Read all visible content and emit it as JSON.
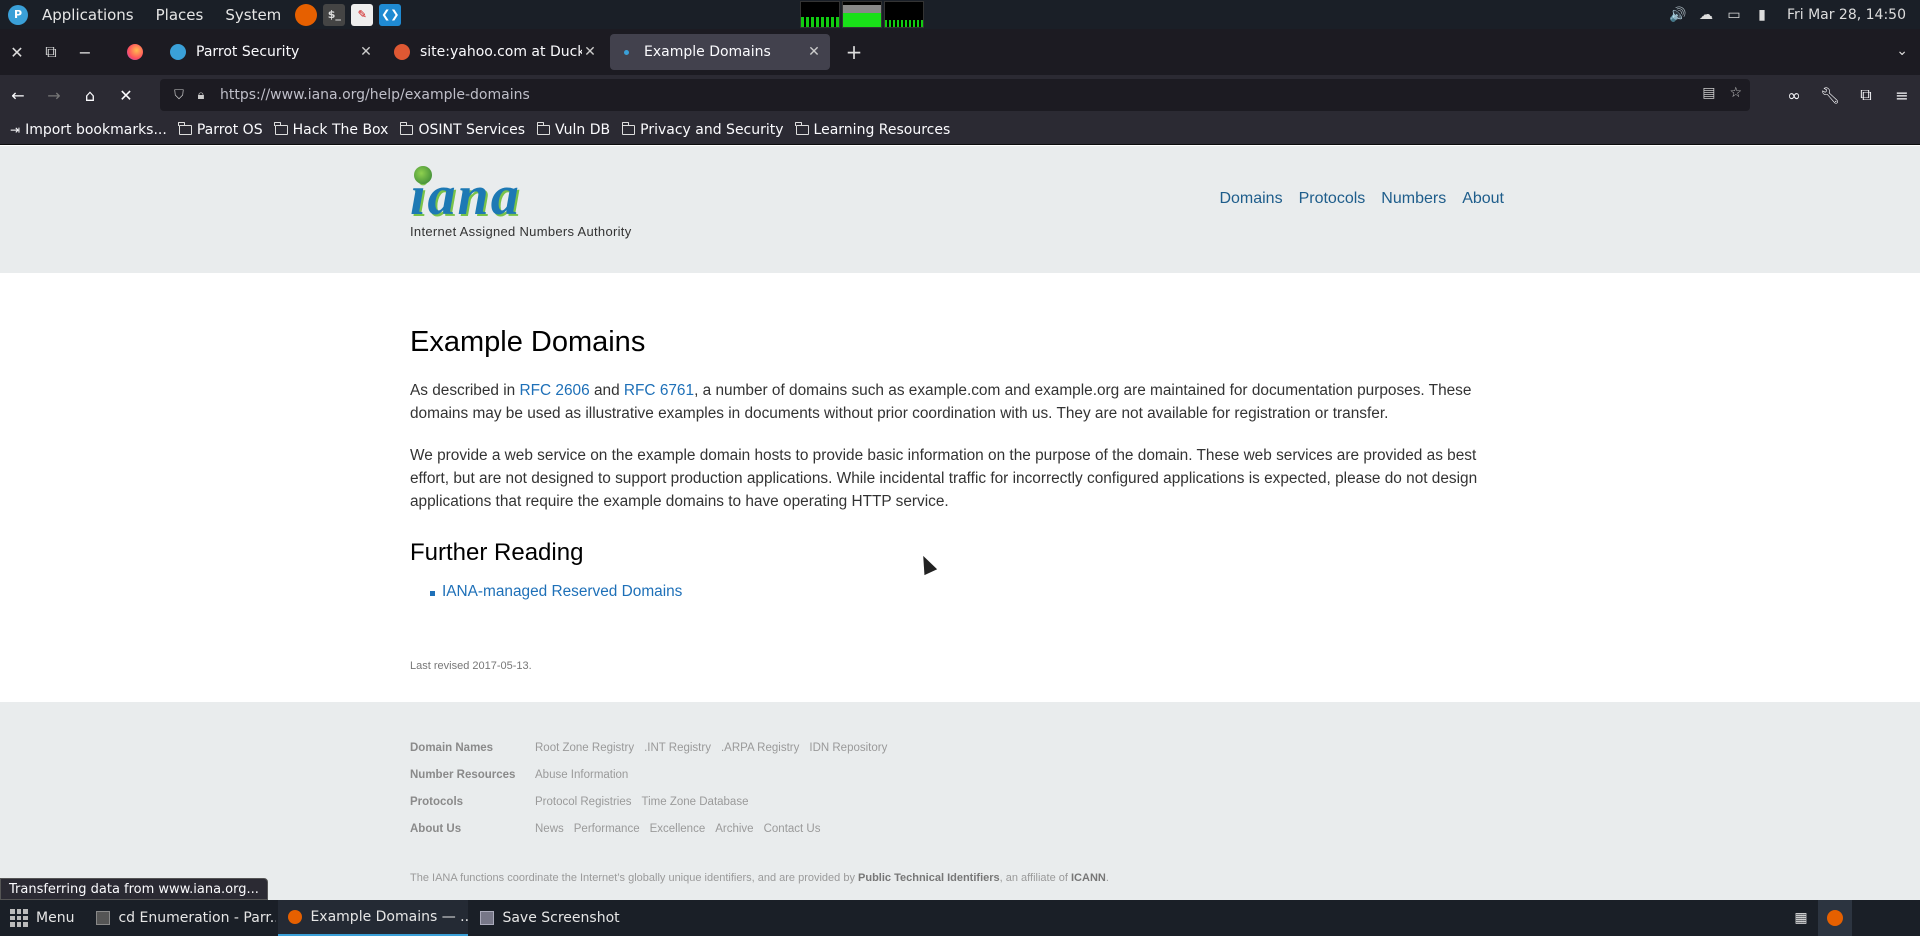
{
  "os_panel": {
    "menus": [
      "Applications",
      "Places",
      "System"
    ],
    "clock": "Fri Mar 28, 14:50"
  },
  "browser": {
    "tabs": [
      {
        "title": "Parrot Security",
        "active": false
      },
      {
        "title": "site:yahoo.com at DuckDuckGo",
        "active": false
      },
      {
        "title": "Example Domains",
        "active": true
      }
    ],
    "url": "https://www.iana.org/help/example-domains",
    "bookmarks": [
      "Import bookmarks...",
      "Parrot OS",
      "Hack The Box",
      "OSINT Services",
      "Vuln DB",
      "Privacy and Security",
      "Learning Resources"
    ],
    "status": "Transferring data from www.iana.org..."
  },
  "page": {
    "logo_word": "iana",
    "logo_tagline": "Internet Assigned Numbers Authority",
    "nav": [
      "Domains",
      "Protocols",
      "Numbers",
      "About"
    ],
    "title": "Example Domains",
    "p1_prefix": "As described in ",
    "rfc1": "RFC 2606",
    "p1_and": " and ",
    "rfc2": "RFC 6761",
    "p1_rest": ", a number of domains such as example.com and example.org are maintained for documentation purposes. These domains may be used as illustrative examples in documents without prior coordination with us. They are not available for registration or transfer.",
    "p2": "We provide a web service on the example domain hosts to provide basic information on the purpose of the domain. These web services are provided as best effort, but are not designed to support production applications. While incidental traffic for incorrectly configured applications is expected, please do not design applications that require the example domains to have operating HTTP service.",
    "further_heading": "Further Reading",
    "further_link": "IANA-managed Reserved Domains",
    "revised": "Last revised 2017-05-13."
  },
  "footer": {
    "rows": [
      {
        "head": "Domain Names",
        "links": [
          "Root Zone Registry",
          ".INT Registry",
          ".ARPA Registry",
          "IDN Repository"
        ]
      },
      {
        "head": "Number Resources",
        "links": [
          "Abuse Information"
        ]
      },
      {
        "head": "Protocols",
        "links": [
          "Protocol Registries",
          "Time Zone Database"
        ]
      },
      {
        "head": "About Us",
        "links": [
          "News",
          "Performance",
          "Excellence",
          "Archive",
          "Contact Us"
        ]
      }
    ],
    "note_prefix": "The IANA functions coordinate the Internet’s globally unique identifiers, and are provided by ",
    "note_pti": "Public Technical Identifiers",
    "note_mid": ", an affiliate of ",
    "note_icann": "ICANN",
    "note_end": "."
  },
  "taskbar": {
    "menu_label": "Menu",
    "tasks": [
      {
        "label": "cd Enumeration - Parr...",
        "icon": "terminal-icon",
        "active": false
      },
      {
        "label": "Example Domains — ...",
        "icon": "firefox-icon",
        "active": true
      },
      {
        "label": "Save Screenshot",
        "icon": "screenshot-icon",
        "active": false
      }
    ]
  },
  "colors": {
    "link": "#1e70b8",
    "header_bg": "#e9eced",
    "panel_bg": "#1a1f27"
  }
}
